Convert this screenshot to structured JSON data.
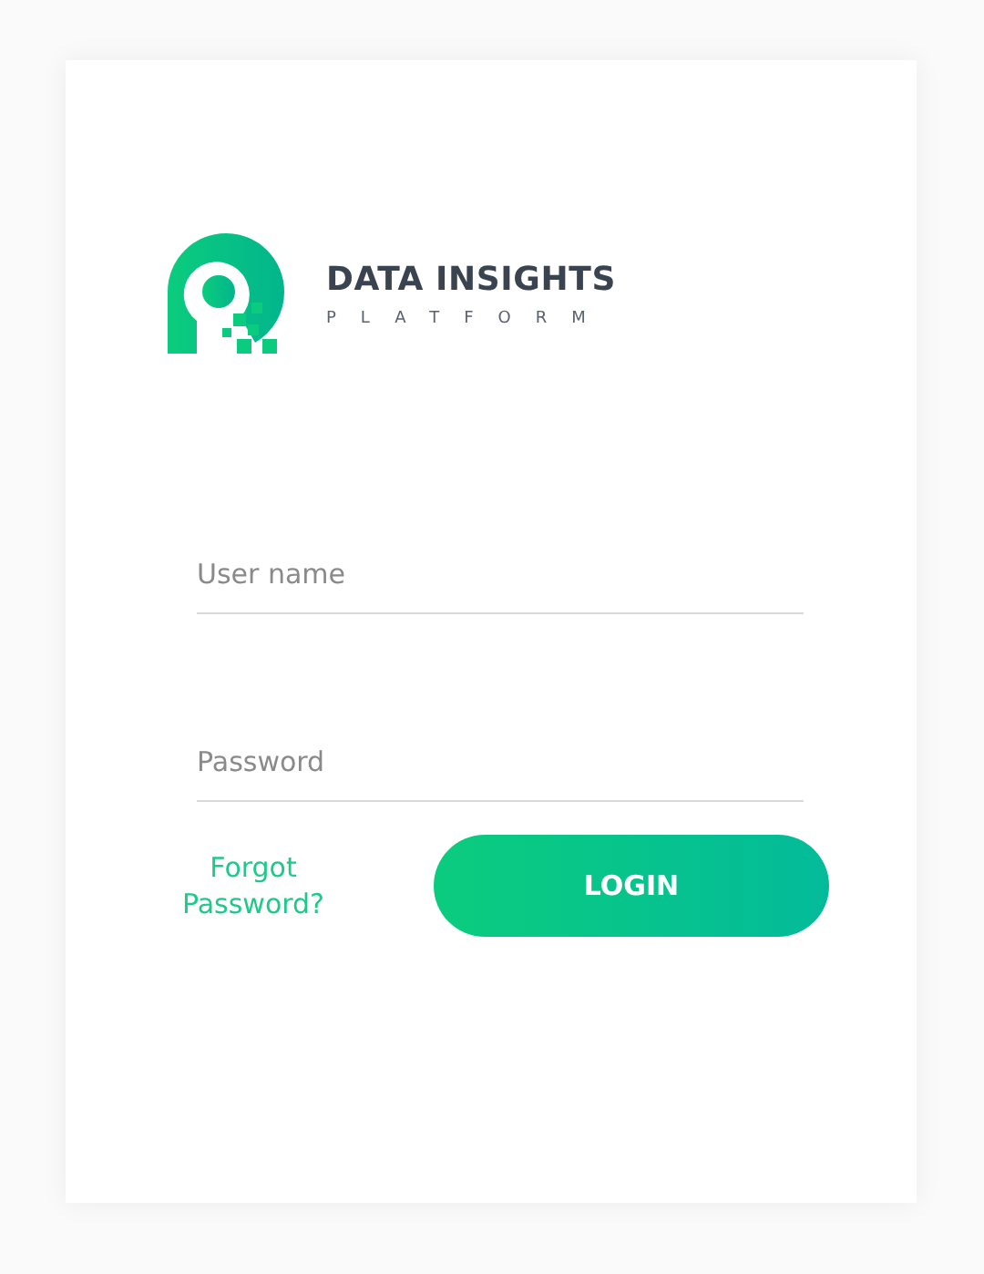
{
  "logo": {
    "title": "DATA INSIGHTS",
    "subtitle": "PLATFORM"
  },
  "fields": [
    {
      "placeholder": "User name"
    },
    {
      "placeholder": "Password"
    }
  ],
  "forgot_link": "Forgot Password?",
  "login_button": "LOGIN"
}
